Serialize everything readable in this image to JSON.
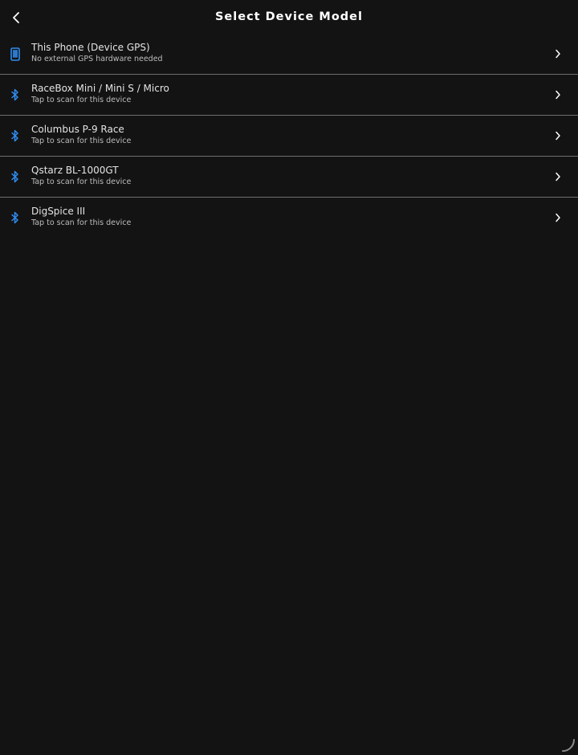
{
  "header": {
    "back_icon": "chevron-left-icon",
    "title": "Select Device Model"
  },
  "devices": [
    {
      "title": "This Phone (Device GPS)",
      "subtitle": "No external GPS hardware needed",
      "icon": "phone-icon"
    },
    {
      "title": "RaceBox Mini / Mini S / Micro",
      "subtitle": "Tap to scan for this device",
      "icon": "bluetooth-icon"
    },
    {
      "title": "Columbus P-9 Race",
      "subtitle": "Tap to scan for this device",
      "icon": "bluetooth-icon"
    },
    {
      "title": "Qstarz BL-1000GT",
      "subtitle": "Tap to scan for this device",
      "icon": "bluetooth-icon"
    },
    {
      "title": "DigSpice III",
      "subtitle": "Tap to scan for this device",
      "icon": "bluetooth-icon"
    }
  ],
  "colors": {
    "background": "#131313",
    "accent": "#2f8cf0",
    "divider": "#6e6e6e",
    "text_primary": "#e4e4e4",
    "text_secondary": "#bdbdbd"
  },
  "footer": {
    "spinner_icon": "loading-spinner-icon"
  }
}
